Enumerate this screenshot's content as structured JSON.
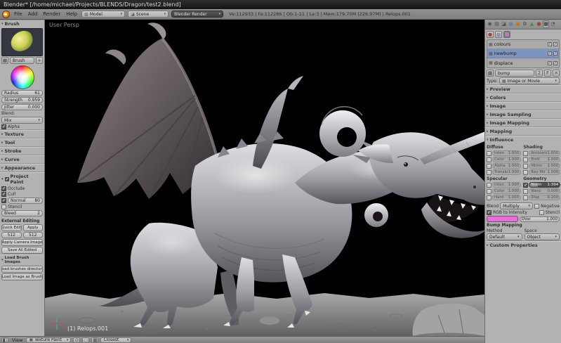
{
  "icons": {
    "collapse": "▾",
    "expand": "▸",
    "dropdown": "▾",
    "close": "✕",
    "check": "✓",
    "plus": "+",
    "browse": "▦",
    "photo": "▦"
  },
  "window": {
    "title": "Blender* [/home/michael/Projects/BLENDS/Dragon/test2.blend]"
  },
  "info_bar": {
    "menus": [
      "File",
      "Add",
      "Render",
      "Help"
    ],
    "layout": "Model",
    "scene": "Scene",
    "engine": "Blender Render",
    "stats": "Ve:112933 | Fa:112286 | Ob:1-11 | La:3 | Mem:179.70M (226.97M) | Relops.001"
  },
  "viewport": {
    "view_label": "User Persp",
    "object_label": "(1) Relops.001"
  },
  "tool_shelf": {
    "brush_panel": "Brush",
    "brush_name": "Brush",
    "sliders": {
      "radius": {
        "label": "Radius",
        "value": "61"
      },
      "strength": {
        "label": "Strength",
        "value": "0.959"
      },
      "jitter": {
        "label": "Jitter",
        "value": "0.000"
      }
    },
    "blend_label": "Blend:",
    "blend_value": "Mix",
    "alpha": "Alpha",
    "panels": [
      "Texture",
      "Tool",
      "Stroke",
      "Curve",
      "Appearance"
    ],
    "project_paint": {
      "title": "Project Paint",
      "occlude": "Occlude",
      "cull": "Cull",
      "normal_label": "Normal",
      "normal_value": "80",
      "stencil": "Stencil",
      "bleed_label": "Bleed",
      "bleed_value": "2"
    },
    "external_editing": {
      "title": "External Editing",
      "quick_edit": "Quick Edit",
      "apply": "Apply",
      "width": "512",
      "height": "512",
      "apply_camera": "Apply Camera Image",
      "save_all": "Save All Edited"
    },
    "load_brush": {
      "title": "Load Brush Images",
      "load_dir": "Load brushes directory",
      "load_image": "Load Image as Brush"
    }
  },
  "properties": {
    "tabs": [
      {
        "name": "render",
        "glyph": "◉"
      },
      {
        "name": "render-layers",
        "glyph": "▤"
      },
      {
        "name": "scene",
        "glyph": "◪"
      },
      {
        "name": "world",
        "glyph": "◍"
      },
      {
        "name": "object",
        "glyph": "▣"
      },
      {
        "name": "modifiers",
        "glyph": "⚙"
      },
      {
        "name": "data",
        "glyph": "▲"
      },
      {
        "name": "material",
        "glyph": "●"
      },
      {
        "name": "texture",
        "glyph": "▦"
      },
      {
        "name": "physics",
        "glyph": "◔"
      }
    ],
    "context_tabs": [
      {
        "name": "material-textures",
        "glyph": "●"
      },
      {
        "name": "world-textures",
        "glyph": "◍"
      },
      {
        "name": "brush-textures",
        "glyph": "▦"
      }
    ],
    "texture_slots": [
      {
        "name": "colours",
        "selected": false
      },
      {
        "name": "newbump",
        "selected": true
      },
      {
        "name": "displace",
        "selected": false
      }
    ],
    "datablock": {
      "name": "bump",
      "users": "2",
      "fake": "F"
    },
    "type_label": "Type:",
    "type_value": "Image or Movie",
    "collapsed_panels": [
      "Preview",
      "Colors",
      "Image",
      "Image Sampling",
      "Image Mapping",
      "Mapping"
    ],
    "influence": {
      "title": "Influence",
      "diffuse_label": "Diffuse",
      "shading_label": "Shading",
      "diffuse": [
        {
          "label": "Inten",
          "value": "1.000"
        },
        {
          "label": "Color",
          "value": "1.000"
        },
        {
          "label": "Alpha",
          "value": "1.000"
        },
        {
          "label": "Translu",
          "value": "1.000"
        }
      ],
      "shading": [
        {
          "label": "Ambient",
          "value": "1.000"
        },
        {
          "label": "Emit",
          "value": "1.000"
        },
        {
          "label": "Mirror",
          "value": "1.000"
        },
        {
          "label": "Ray Mir",
          "value": "1.000"
        }
      ],
      "specular_label": "Specular",
      "geometry_label": "Geometry",
      "specular": [
        {
          "label": "Inten",
          "value": "1.000"
        },
        {
          "label": "Color",
          "value": "1.000"
        },
        {
          "label": "Hard",
          "value": "1.000"
        }
      ],
      "geometry": [
        {
          "label": "Norm",
          "value": "1.394"
        },
        {
          "label": "Warp",
          "value": "0.000"
        },
        {
          "label": "Disp",
          "value": "0.200"
        }
      ],
      "blend_label": "Blend",
      "blend_value": "Multiply",
      "negative": "Negative",
      "rgb_to_intensity": "RGB to Intensity",
      "stencil": "Stencil",
      "swatch_color": "#e56fd8",
      "dvar_label": "DVar",
      "dvar_value": "1.000",
      "bump_mapping": "Bump Mapping",
      "method_label": "Method",
      "method_value": "Default",
      "space_label": "Space",
      "space_value": "Object"
    },
    "custom_properties": "Custom Properties"
  },
  "footer": {
    "view_menu": "View",
    "mode": "Texture Paint",
    "sampling": "Closest"
  }
}
